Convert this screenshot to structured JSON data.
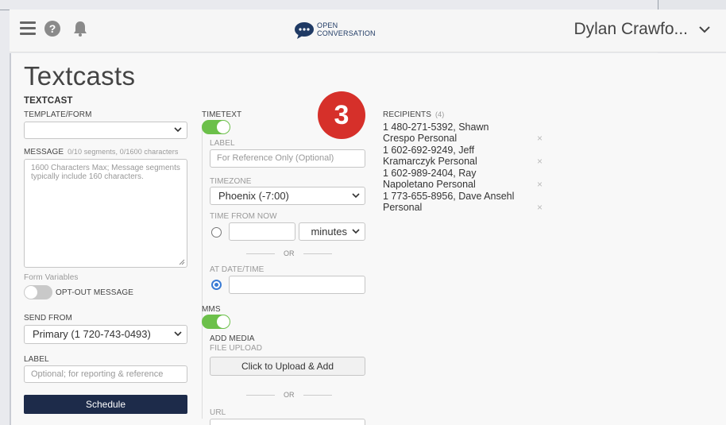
{
  "header": {
    "logo_line1": "OPEN",
    "logo_line2": "CONVERSATION",
    "user_name": "Dylan Crawfo..."
  },
  "page": {
    "title": "Textcasts",
    "section": "TEXTCAST"
  },
  "left": {
    "template_label": "TEMPLATE/FORM",
    "template_value": "",
    "message_label": "MESSAGE",
    "message_counter": "0/10 segments, 0/1600 characters",
    "message_placeholder": "1600 Characters Max; Message segments typically include 160 characters.",
    "form_variables": "Form Variables",
    "optout_label": "OPT-OUT MESSAGE",
    "send_from_label": "SEND FROM",
    "send_from_value": "Primary (1 720-743-0493)",
    "label_label": "LABEL",
    "label_placeholder": "Optional; for reporting & reference",
    "schedule_button": "Schedule"
  },
  "middle": {
    "timetext_label": "TIMETEXT",
    "label_label": "LABEL",
    "label_placeholder": "For Reference Only (Optional)",
    "timezone_label": "TIMEZONE",
    "timezone_value": "Phoenix (-7:00)",
    "time_from_now_label": "TIME FROM NOW",
    "time_unit": "minutes",
    "or1": "OR",
    "at_datetime_label": "AT DATE/TIME",
    "mms_label": "MMS",
    "add_media_label": "ADD MEDIA",
    "file_upload_label": "FILE UPLOAD",
    "upload_button": "Click to Upload & Add",
    "or2": "OR",
    "url_label": "URL"
  },
  "recipients": {
    "title": "RECIPIENTS",
    "count": "(4)",
    "items": [
      {
        "line1": "1 480-271-5392, Shawn",
        "line2": "Crespo Personal"
      },
      {
        "line1": "1 602-692-9249, Jeff",
        "line2": "Kramarczyk Personal"
      },
      {
        "line1": "1 602-989-2404, Ray",
        "line2": "Napoletano Personal"
      },
      {
        "line1": "1 773-655-8956, Dave Ansehl",
        "line2": "Personal"
      }
    ],
    "remove_symbol": "×"
  },
  "callout": {
    "number": "3"
  },
  "colors": {
    "toggle_on": "#6cc04a",
    "primary": "#1d2b4a",
    "badge": "#d6302a"
  }
}
